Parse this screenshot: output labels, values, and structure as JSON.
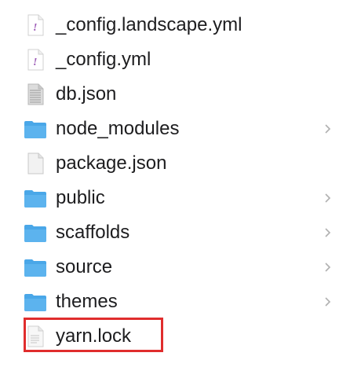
{
  "files": [
    {
      "name": "_config.landscape.yml",
      "icon": "yaml-file-icon",
      "folder": false
    },
    {
      "name": "_config.yml",
      "icon": "yaml-file-icon",
      "folder": false
    },
    {
      "name": "db.json",
      "icon": "json-file-icon",
      "folder": false
    },
    {
      "name": "node_modules",
      "icon": "folder-icon",
      "folder": true
    },
    {
      "name": "package.json",
      "icon": "document-file-icon",
      "folder": false
    },
    {
      "name": "public",
      "icon": "folder-icon",
      "folder": true
    },
    {
      "name": "scaffolds",
      "icon": "folder-icon",
      "folder": true
    },
    {
      "name": "source",
      "icon": "folder-icon",
      "folder": true
    },
    {
      "name": "themes",
      "icon": "folder-icon",
      "folder": true
    },
    {
      "name": "yarn.lock",
      "icon": "text-file-icon",
      "folder": false
    }
  ],
  "highlighted_item": "yarn.lock",
  "colors": {
    "folder": "#4aa7e8",
    "highlight_border": "#e02d2d",
    "yaml_mark": "#9b59b6",
    "chevron": "#b0b0b0"
  }
}
